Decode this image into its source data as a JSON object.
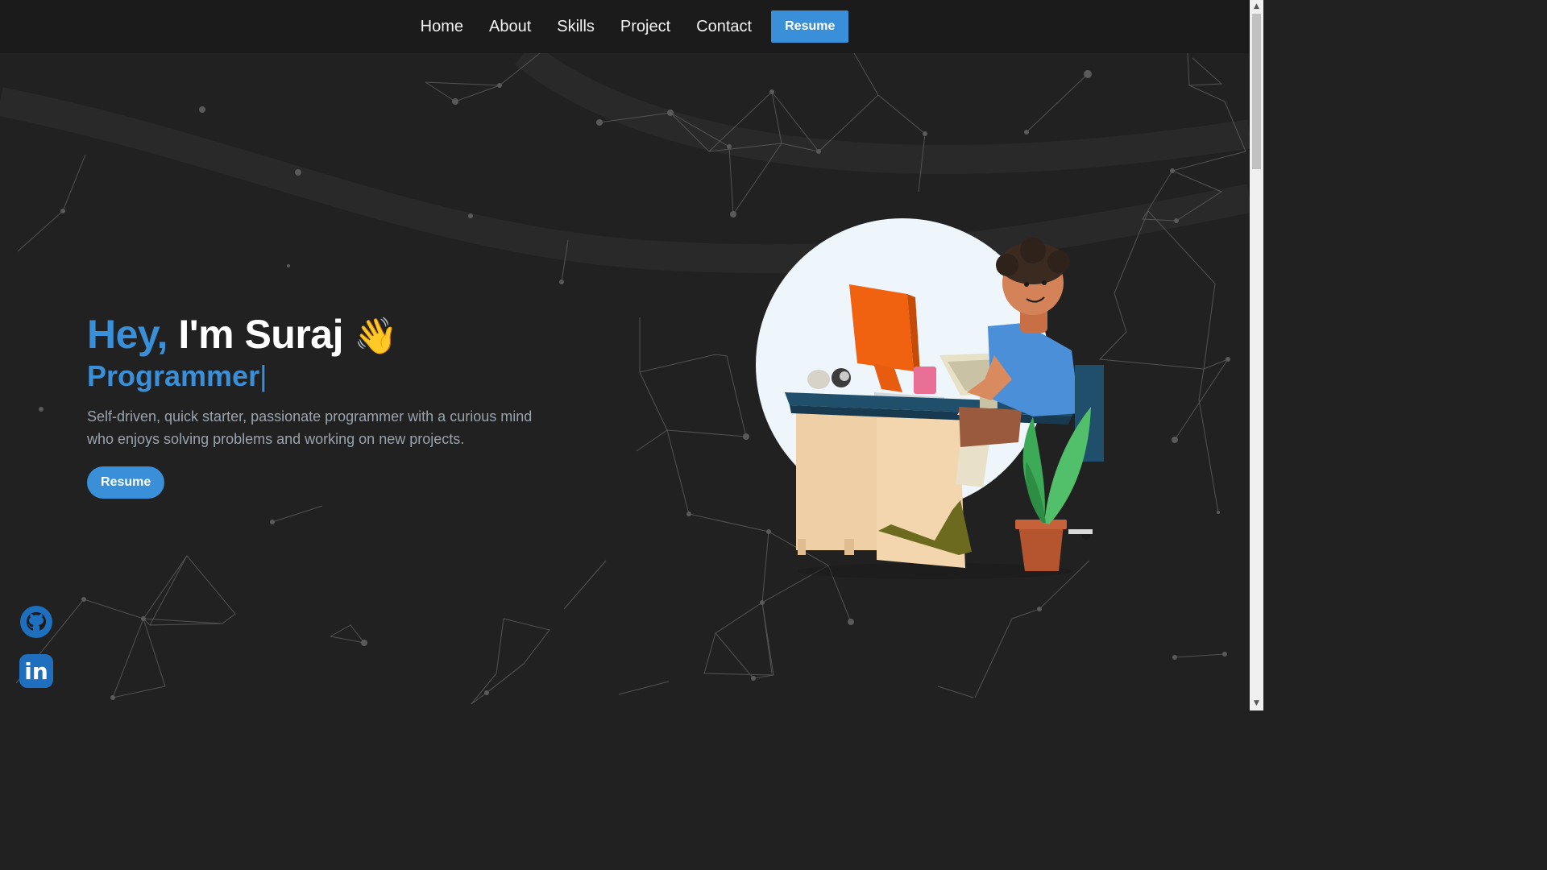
{
  "nav": {
    "links": [
      "Home",
      "About",
      "Skills",
      "Project",
      "Contact"
    ],
    "resume_label": "Resume"
  },
  "hero": {
    "greeting": "Hey,",
    "name": "I'm Suraj",
    "wave_emoji": "👋",
    "role": "Programmer",
    "cursor": "|",
    "description": "Self-driven, quick starter, passionate programmer with a curious mind who enjoys solving problems and working on new projects.",
    "button_label": "Resume"
  },
  "social": {
    "github_icon": "github-icon",
    "linkedin_icon": "linkedin-icon",
    "linkedin_text": "in"
  },
  "colors": {
    "accent": "#3a8fd9",
    "background": "#212121",
    "navbar": "#1b1b1b"
  }
}
